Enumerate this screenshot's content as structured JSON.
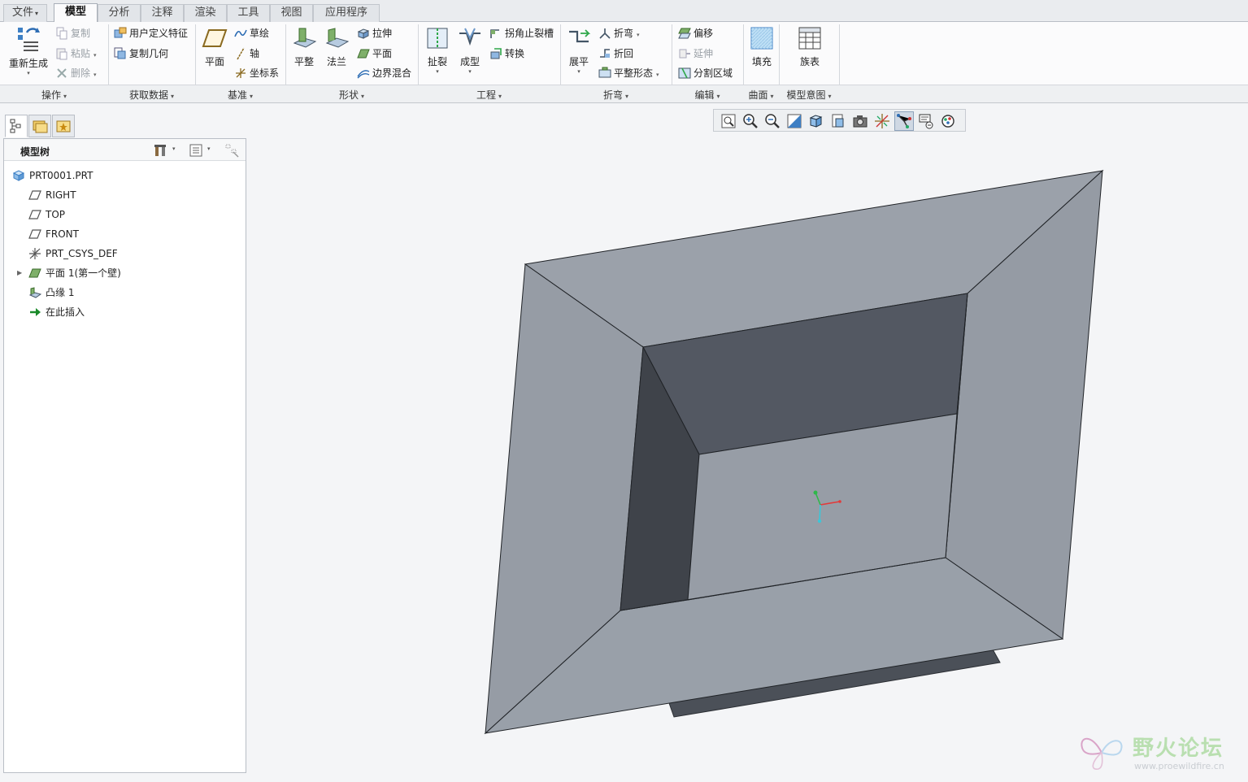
{
  "tabs": [
    {
      "label": "文件",
      "caret": "▾"
    },
    {
      "label": "模型"
    },
    {
      "label": "分析"
    },
    {
      "label": "注释"
    },
    {
      "label": "渲染"
    },
    {
      "label": "工具"
    },
    {
      "label": "视图"
    },
    {
      "label": "应用程序"
    }
  ],
  "ribbon": {
    "operations": {
      "regenerate": "重新生成",
      "copy": "复制",
      "paste": "粘贴",
      "delete": "删除",
      "group": "操作"
    },
    "get_data": {
      "udf": "用户定义特征",
      "copy_geom": "复制几何",
      "group": "获取数据"
    },
    "datum": {
      "plane": "平面",
      "sketch": "草绘",
      "axis": "轴",
      "csys": "坐标系",
      "group": "基准"
    },
    "shapes": {
      "flat": "平整",
      "flange": "法兰",
      "extrude": "拉伸",
      "planar": "平面",
      "boundary_blend": "边界混合",
      "group": "形状"
    },
    "engineering": {
      "rip": "扯裂",
      "form": "成型",
      "corner_relief": "拐角止裂槽",
      "convert": "转换",
      "group": "工程"
    },
    "bends": {
      "unbend": "展平",
      "bend": "折弯",
      "bend_back": "折回",
      "flat_pattern": "平整形态",
      "group": "折弯"
    },
    "editing": {
      "offset": "偏移",
      "extend": "延伸",
      "split_area": "分割区域",
      "group": "编辑"
    },
    "surfaces": {
      "fill": "填充",
      "group": "曲面"
    },
    "model_intent": {
      "family_table": "族表",
      "group": "模型意图"
    },
    "caret": "▾"
  },
  "model_tree": {
    "title": "模型树",
    "items": [
      {
        "label": "PRT0001.PRT",
        "icon": "part-icon"
      },
      {
        "label": "RIGHT",
        "icon": "datum-plane-icon"
      },
      {
        "label": "TOP",
        "icon": "datum-plane-icon"
      },
      {
        "label": "FRONT",
        "icon": "datum-plane-icon"
      },
      {
        "label": "PRT_CSYS_DEF",
        "icon": "csys-icon"
      },
      {
        "label": "平面 1(第一个壁)",
        "icon": "planar-wall-icon",
        "expandable": true
      },
      {
        "label": "凸缘 1",
        "icon": "flange-icon"
      },
      {
        "label": "在此插入",
        "icon": "insert-here-icon"
      }
    ],
    "expander": "▶"
  },
  "graphics_toolbar": {
    "buttons": [
      "refit-icon",
      "zoom-in-icon",
      "zoom-out-icon",
      "repaint-icon",
      "display-style-icon",
      "saved-views-icon",
      "view-manager-icon",
      "datum-display-icon",
      "spin-center-icon",
      "annotation-display-icon",
      "appearance-icon"
    ],
    "active_index": 8
  },
  "watermark": {
    "title": "野火论坛",
    "url": "www.proewildfire.cn"
  },
  "colors": {
    "model_face": "#979da6",
    "model_dark": "#515660",
    "model_side": "#3d4148",
    "csys_x": "#e23a3a",
    "csys_y": "#2fb84a",
    "csys_z": "#3cc6d8"
  }
}
